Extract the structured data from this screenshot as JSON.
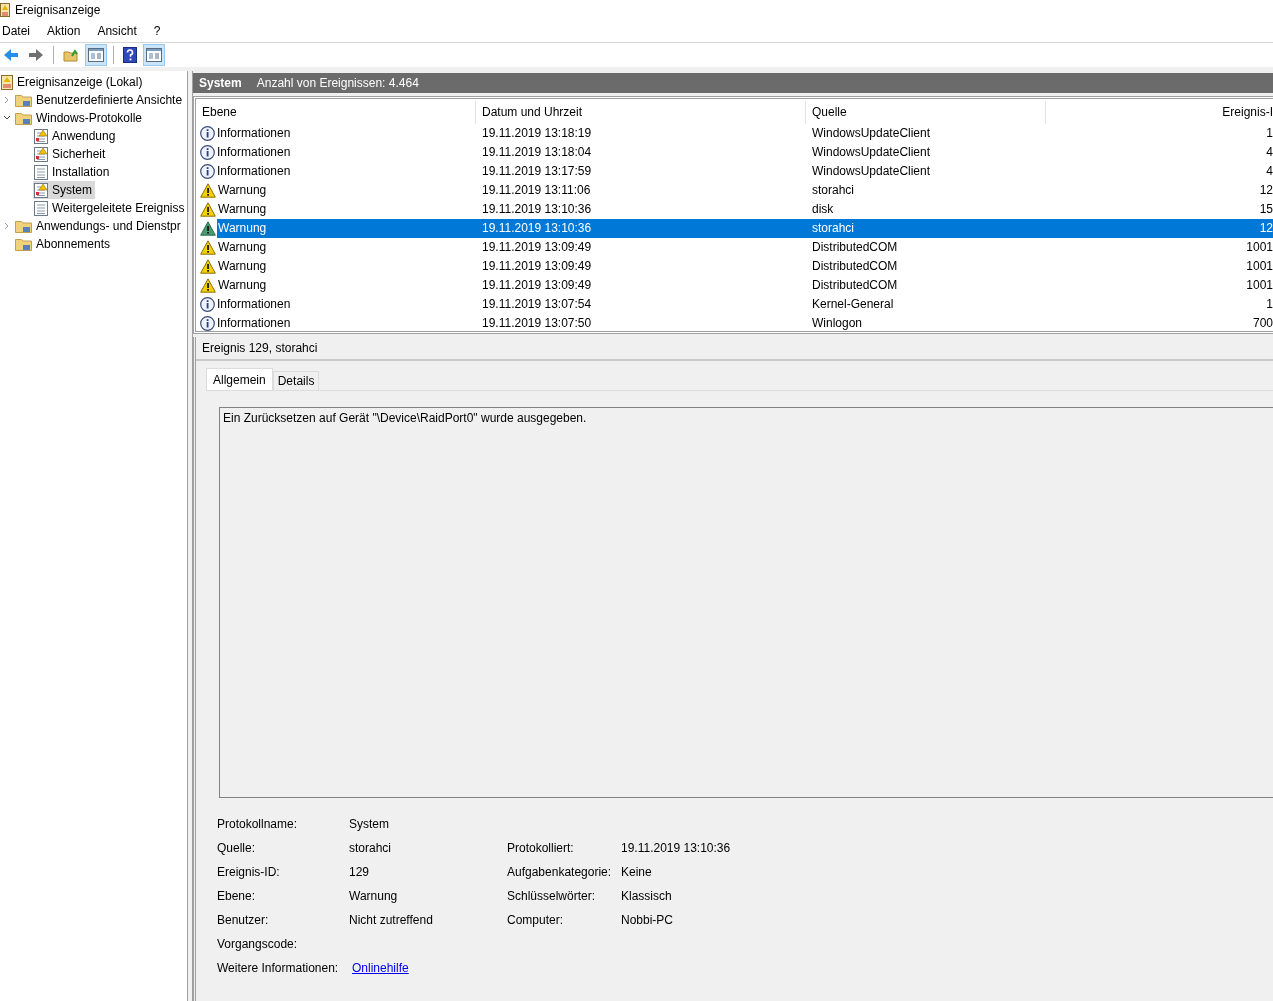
{
  "window": {
    "title": "Ereignisanzeige"
  },
  "menu": [
    "Datei",
    "Aktion",
    "Ansicht",
    "?"
  ],
  "toolbar": [
    {
      "kind": "back"
    },
    {
      "kind": "forward"
    },
    {
      "kind": "sep"
    },
    {
      "kind": "folder"
    },
    {
      "kind": "pane",
      "selected": true
    },
    {
      "kind": "sep"
    },
    {
      "kind": "help"
    },
    {
      "kind": "pane",
      "selected": true
    }
  ],
  "tree": [
    {
      "label": "Ereignisanzeige (Lokal)",
      "kind": "root",
      "selected": false,
      "children": [
        {
          "label": "Benutzerdefinierte Ansichte",
          "kind": "folder",
          "selected": false,
          "expanded": false
        },
        {
          "label": "Windows-Protokolle",
          "kind": "folder",
          "selected": false,
          "expanded": true,
          "children": [
            {
              "label": "Anwendung",
              "kind": "log-warn",
              "selected": false
            },
            {
              "label": "Sicherheit",
              "kind": "log-warn",
              "selected": false
            },
            {
              "label": "Installation",
              "kind": "log",
              "selected": false
            },
            {
              "label": "System",
              "kind": "log-warn",
              "selected": true
            },
            {
              "label": "Weitergeleitete Ereigniss",
              "kind": "log",
              "selected": false
            }
          ]
        },
        {
          "label": "Anwendungs- und Dienstpr",
          "kind": "folder",
          "selected": false,
          "expanded": false
        },
        {
          "label": "Abonnements",
          "kind": "folder",
          "selected": false
        }
      ]
    }
  ],
  "log_header": {
    "name": "System",
    "count": "Anzahl von Ereignissen: 4.464"
  },
  "table": {
    "columns": [
      "Ebene",
      "Datum und Uhrzeit",
      "Quelle",
      "Ereignis-I"
    ],
    "rows": [
      {
        "kind": "info",
        "level": "Informationen",
        "date": "19.11.2019 13:18:19",
        "source": "WindowsUpdateClient",
        "id": "1",
        "selected": false
      },
      {
        "kind": "info",
        "level": "Informationen",
        "date": "19.11.2019 13:18:04",
        "source": "WindowsUpdateClient",
        "id": "4",
        "selected": false
      },
      {
        "kind": "info",
        "level": "Informationen",
        "date": "19.11.2019 13:17:59",
        "source": "WindowsUpdateClient",
        "id": "4",
        "selected": false
      },
      {
        "kind": "warning",
        "level": "Warnung",
        "date": "19.11.2019 13:11:06",
        "source": "storahci",
        "id": "12",
        "selected": false
      },
      {
        "kind": "warning",
        "level": "Warnung",
        "date": "19.11.2019 13:10:36",
        "source": "disk",
        "id": "15",
        "selected": false
      },
      {
        "kind": "warning",
        "level": "Warnung",
        "date": "19.11.2019 13:10:36",
        "source": "storahci",
        "id": "12",
        "selected": true
      },
      {
        "kind": "warning",
        "level": "Warnung",
        "date": "19.11.2019 13:09:49",
        "source": "DistributedCOM",
        "id": "1001",
        "selected": false
      },
      {
        "kind": "warning",
        "level": "Warnung",
        "date": "19.11.2019 13:09:49",
        "source": "DistributedCOM",
        "id": "1001",
        "selected": false
      },
      {
        "kind": "warning",
        "level": "Warnung",
        "date": "19.11.2019 13:09:49",
        "source": "DistributedCOM",
        "id": "1001",
        "selected": false
      },
      {
        "kind": "info",
        "level": "Informationen",
        "date": "19.11.2019 13:07:54",
        "source": "Kernel-General",
        "id": "1",
        "selected": false
      },
      {
        "kind": "info",
        "level": "Informationen",
        "date": "19.11.2019 13:07:50",
        "source": "Winlogon",
        "id": "700",
        "selected": false
      }
    ]
  },
  "detail": {
    "title": "Ereignis 129, storahci",
    "tabs": [
      {
        "label": "Allgemein",
        "selected": true
      },
      {
        "label": "Details",
        "selected": false
      }
    ],
    "message": "Ein Zurücksetzen auf Gerät \"\\Device\\RaidPort0\" wurde ausgegeben.",
    "fields": [
      {
        "left": {
          "label": "Protokollname:",
          "value": "System"
        }
      },
      {
        "left": {
          "label": "Quelle:",
          "value": "storahci"
        },
        "right": {
          "label": "Protokolliert:",
          "value": "19.11.2019 13:10:36"
        }
      },
      {
        "left": {
          "label": "Ereignis-ID:",
          "value": "129"
        },
        "right": {
          "label": "Aufgabenkategorie:",
          "value": "Keine"
        }
      },
      {
        "left": {
          "label": "Ebene:",
          "value": "Warnung"
        },
        "right": {
          "label": "Schlüsselwörter:",
          "value": "Klassisch"
        }
      },
      {
        "left": {
          "label": "Benutzer:",
          "value": "Nicht zutreffend"
        },
        "right": {
          "label": "Computer:",
          "value": "Nobbi-PC"
        }
      },
      {
        "left": {
          "label": "Vorgangscode:"
        }
      },
      {
        "left": {
          "label": "Weitere Informationen:",
          "link": "Onlinehilfe"
        }
      }
    ]
  }
}
